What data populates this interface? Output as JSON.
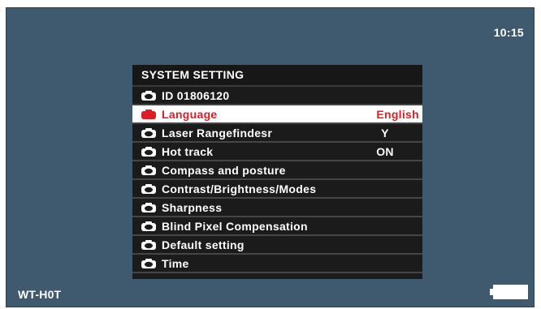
{
  "status": {
    "time": "10:15",
    "device_label": "WT-H0T"
  },
  "colors": {
    "screen_bg": "#3f5a6f",
    "menu_bg": "#1b1b1b",
    "selected_bg": "#ffffff",
    "selected_text": "#e01c24",
    "text": "#ffffff"
  },
  "menu": {
    "title": "SYSTEM SETTING",
    "items": [
      {
        "label": "ID 01806120",
        "value": "",
        "selected": false,
        "icon": "camera-icon"
      },
      {
        "label": "Language",
        "value": "English",
        "selected": true,
        "icon": "camera-icon"
      },
      {
        "label": "Laser Rangefindesr",
        "value": "Y",
        "selected": false,
        "icon": "camera-icon"
      },
      {
        "label": "Hot track",
        "value": "ON",
        "selected": false,
        "icon": "camera-icon"
      },
      {
        "label": "Compass and posture",
        "value": "",
        "selected": false,
        "icon": "camera-icon"
      },
      {
        "label": "Contrast/Brightness/Modes",
        "value": "",
        "selected": false,
        "icon": "camera-icon"
      },
      {
        "label": "Sharpness",
        "value": "",
        "selected": false,
        "icon": "camera-icon"
      },
      {
        "label": "Blind Pixel Compensation",
        "value": "",
        "selected": false,
        "icon": "camera-icon"
      },
      {
        "label": "Default setting",
        "value": "",
        "selected": false,
        "icon": "camera-icon"
      },
      {
        "label": "Time",
        "value": "",
        "selected": false,
        "icon": "camera-icon"
      }
    ]
  },
  "battery": {
    "icon": "battery-icon",
    "level": 1.0
  }
}
